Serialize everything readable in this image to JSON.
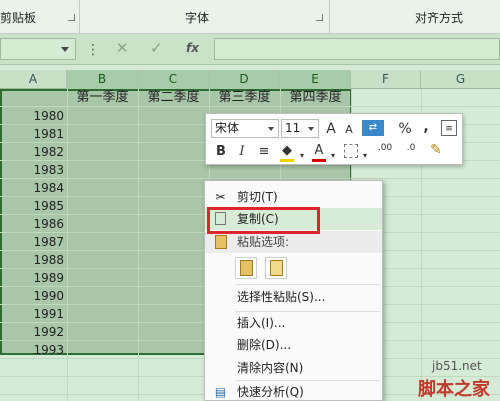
{
  "ribbon": {
    "groups": [
      "剪贴板",
      "字体",
      "对齐方式"
    ]
  },
  "formula_bar": {
    "name_box_value": "",
    "fx_label": "fx",
    "formula_value": ""
  },
  "columns": [
    "A",
    "B",
    "C",
    "D",
    "E",
    "F",
    "G"
  ],
  "quarters": [
    "第一季度",
    "第二季度",
    "第三季度",
    "第四季度"
  ],
  "years": [
    "1980",
    "1981",
    "1982",
    "1983",
    "1984",
    "1985",
    "1986",
    "1987",
    "1988",
    "1989",
    "1990",
    "1991",
    "1992",
    "1993"
  ],
  "mini_toolbar": {
    "font_name": "宋体",
    "font_size": "11",
    "icons": [
      "increase-font-icon",
      "decrease-font-icon",
      "format-icon",
      "percent-icon",
      "comma-icon",
      "table-format-icon",
      "bold-icon",
      "italic-icon",
      "align-center-icon",
      "fill-color-icon",
      "font-color-icon",
      "borders-icon",
      "increase-decimal-icon",
      "decrease-decimal-icon",
      "format-painter-icon"
    ],
    "labels": {
      "bold": "B",
      "italic": "I",
      "percent": "%",
      "comma": ",",
      "grow": "A",
      "shrink": "A",
      "font_color": "A",
      "inc_decimal": ".00",
      "dec_decimal": ".0"
    }
  },
  "context_menu": {
    "cut": "剪切(T)",
    "copy": "复制(C)",
    "paste_options": "粘贴选项:",
    "paste_special": "选择性粘贴(S)...",
    "insert": "插入(I)...",
    "delete": "删除(D)...",
    "clear_contents": "清除内容(N)",
    "quick_analysis": "快速分析(Q)"
  },
  "watermark": {
    "site": "jb51.net",
    "brand": "脚本之家"
  },
  "colors": {
    "highlight_box": "#e0242b",
    "selection": "#a8c6a8",
    "selection_border": "#2e6b2e"
  }
}
